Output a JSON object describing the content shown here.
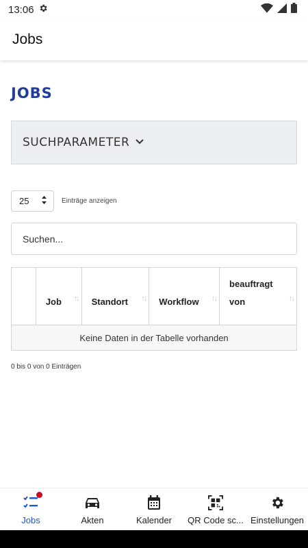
{
  "status_bar": {
    "time": "13:06"
  },
  "app_bar": {
    "title": "Jobs"
  },
  "page": {
    "heading": "JOBS",
    "search_params_label": "SUCHPARAMETER",
    "length_value": "25",
    "length_label": "Einträge anzeigen",
    "search_placeholder": "Suchen...",
    "table": {
      "columns": [
        "",
        "Job",
        "Standort",
        "Workflow",
        "beauftragt von"
      ],
      "empty_message": "Keine Daten in der Tabelle vorhanden"
    },
    "info": "0 bis 0 von 0 Einträgen"
  },
  "bottom_nav": {
    "items": [
      {
        "label": "Jobs",
        "icon": "jobs-checklist-icon",
        "active": true,
        "badge": true
      },
      {
        "label": "Akten",
        "icon": "car-icon"
      },
      {
        "label": "Kalender",
        "icon": "calendar-icon"
      },
      {
        "label": "QR Code sc...",
        "icon": "qr-code-icon"
      },
      {
        "label": "Einstellungen",
        "icon": "gear-icon"
      }
    ]
  },
  "colors": {
    "accent": "#1a56d6",
    "heading": "#1f3d99",
    "badge": "#c4101f"
  }
}
